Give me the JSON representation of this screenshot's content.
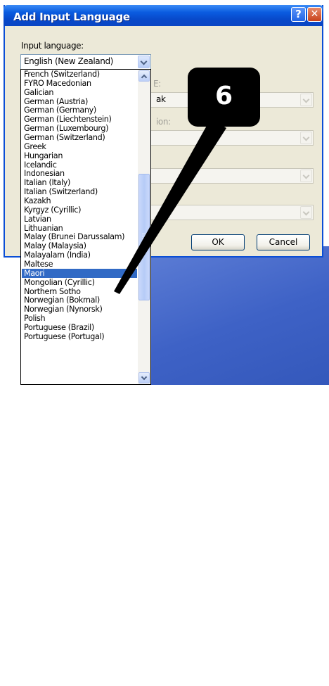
{
  "dialog": {
    "title": "Add Input Language",
    "help_glyph": "?",
    "close_glyph": "✕",
    "input_language_label": "Input language:",
    "input_language_value": "English (New Zealand)",
    "layout_label_partial": "E:",
    "layout_value_partial": "ak",
    "option_label_partial": "ion:",
    "ok_label": "OK",
    "cancel_label": "Cancel"
  },
  "language_list": {
    "items": [
      "French (Switzerland)",
      "FYRO Macedonian",
      "Galician",
      "German (Austria)",
      "German (Germany)",
      "German (Liechtenstein)",
      "German (Luxembourg)",
      "German (Switzerland)",
      "Greek",
      "Hungarian",
      "Icelandic",
      "Indonesian",
      "Italian (Italy)",
      "Italian (Switzerland)",
      "Kazakh",
      "Kyrgyz (Cyrillic)",
      "Latvian",
      "Lithuanian",
      "Malay (Brunei Darussalam)",
      "Malay (Malaysia)",
      "Malayalam (India)",
      "Maltese",
      "Maori",
      "Mongolian (Cyrillic)",
      "Northern Sotho",
      "Norwegian (Bokmal)",
      "Norwegian (Nynorsk)",
      "Polish",
      "Portuguese (Brazil)",
      "Portuguese (Portugal)"
    ],
    "selected": "Maori"
  },
  "callout": {
    "text": "6"
  },
  "colors": {
    "titlebar": "#0a5ce0",
    "selection": "#316ac5",
    "dialog_face": "#ece9d8",
    "callout": "#000000"
  },
  "icons": [
    "help-icon",
    "close-icon",
    "chevron-down-icon",
    "chevron-up-icon"
  ]
}
